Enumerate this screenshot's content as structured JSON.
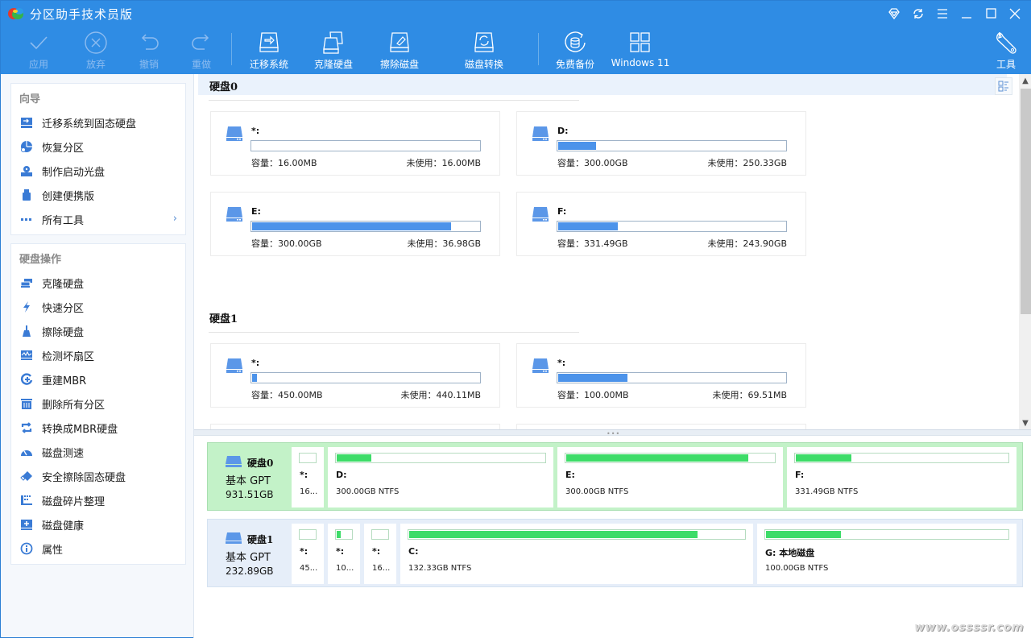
{
  "app": {
    "title": "分区助手技术员版",
    "window_controls": [
      "diamond-icon",
      "refresh-icon",
      "menu-icon",
      "minimize-icon",
      "maximize-icon",
      "close-icon"
    ]
  },
  "toolbar": {
    "apply": "应用",
    "discard": "放弃",
    "undo": "撤销",
    "redo": "重做",
    "migrate_os": "迁移系统",
    "clone_disk": "克隆硬盘",
    "wipe_disk": "擦除磁盘",
    "disk_convert": "磁盘转换",
    "free_backup": "免费备份",
    "windows11": "Windows 11",
    "tools": "工具"
  },
  "sidebar": {
    "wizard": {
      "title": "向导",
      "items": [
        {
          "label": "迁移系统到固态硬盘",
          "icon": "migrate-ssd-icon"
        },
        {
          "label": "恢复分区",
          "icon": "recover-partition-icon"
        },
        {
          "label": "制作启动光盘",
          "icon": "boot-disc-icon"
        },
        {
          "label": "创建便携版",
          "icon": "usb-icon"
        },
        {
          "label": "所有工具",
          "icon": "more-icon",
          "has_arrow": true
        }
      ]
    },
    "disk_ops": {
      "title": "硬盘操作",
      "items": [
        {
          "label": "克隆硬盘",
          "icon": "clone-disk-icon"
        },
        {
          "label": "快速分区",
          "icon": "lightning-icon"
        },
        {
          "label": "擦除硬盘",
          "icon": "broom-icon"
        },
        {
          "label": "检测坏扇区",
          "icon": "bad-sector-icon"
        },
        {
          "label": "重建MBR",
          "icon": "rebuild-mbr-icon"
        },
        {
          "label": "删除所有分区",
          "icon": "trash-icon"
        },
        {
          "label": "转换成MBR硬盘",
          "icon": "convert-icon"
        },
        {
          "label": "磁盘测速",
          "icon": "speedometer-icon"
        },
        {
          "label": "安全擦除固态硬盘",
          "icon": "eraser-icon"
        },
        {
          "label": "磁盘碎片整理",
          "icon": "defrag-icon"
        },
        {
          "label": "磁盘健康",
          "icon": "disk-health-icon"
        },
        {
          "label": "属性",
          "icon": "info-icon"
        }
      ]
    }
  },
  "upper": {
    "disks": [
      {
        "title": "硬盘0",
        "partitions": [
          {
            "name": "*:",
            "used_fraction": 0.0,
            "capacity": "容量：16.00MB",
            "free": "未使用：16.00MB"
          },
          {
            "name": "D:",
            "used_fraction": 0.166,
            "capacity": "容量：300.00GB",
            "free": "未使用：250.33GB"
          },
          {
            "name": "E:",
            "used_fraction": 0.877,
            "capacity": "容量：300.00GB",
            "free": "未使用：36.98GB"
          },
          {
            "name": "F:",
            "used_fraction": 0.264,
            "capacity": "容量：331.49GB",
            "free": "未使用：243.90GB"
          }
        ]
      },
      {
        "title": "硬盘1",
        "partitions": [
          {
            "name": "*:",
            "used_fraction": 0.022,
            "capacity": "容量：450.00MB",
            "free": "未使用：440.11MB"
          },
          {
            "name": "*:",
            "used_fraction": 0.305,
            "capacity": "容量：100.00MB",
            "free": "未使用：69.51MB"
          }
        ]
      }
    ]
  },
  "diskmap": [
    {
      "name": "硬盘0",
      "type": "基本 GPT",
      "size": "931.51GB",
      "selected": true,
      "partitions": [
        {
          "name": "*:",
          "info": "16...",
          "used_fraction": 0.0
        },
        {
          "name": "D:",
          "info": "300.00GB NTFS",
          "used_fraction": 0.166
        },
        {
          "name": "E:",
          "info": "300.00GB NTFS",
          "used_fraction": 0.877
        },
        {
          "name": "F:",
          "info": "331.49GB NTFS",
          "used_fraction": 0.264
        }
      ]
    },
    {
      "name": "硬盘1",
      "type": "基本 GPT",
      "size": "232.89GB",
      "selected": false,
      "partitions": [
        {
          "name": "*:",
          "info": "45...",
          "used_fraction": 0.0
        },
        {
          "name": "*:",
          "info": "10...",
          "used_fraction": 0.305
        },
        {
          "name": "*:",
          "info": "16...",
          "used_fraction": 0.0
        },
        {
          "name": "C:",
          "info": "132.33GB NTFS",
          "used_fraction": 0.86
        },
        {
          "name": "G: 本地磁盘",
          "info": "100.00GB NTFS",
          "used_fraction": 0.31
        }
      ]
    }
  ],
  "colors": {
    "brand": "#2f8ce4",
    "usage_blue": "#4c93ea",
    "usage_green": "#3ddc68",
    "selected_disk_bg": "#c3f2c8"
  },
  "watermark": "www.ossssr.com"
}
